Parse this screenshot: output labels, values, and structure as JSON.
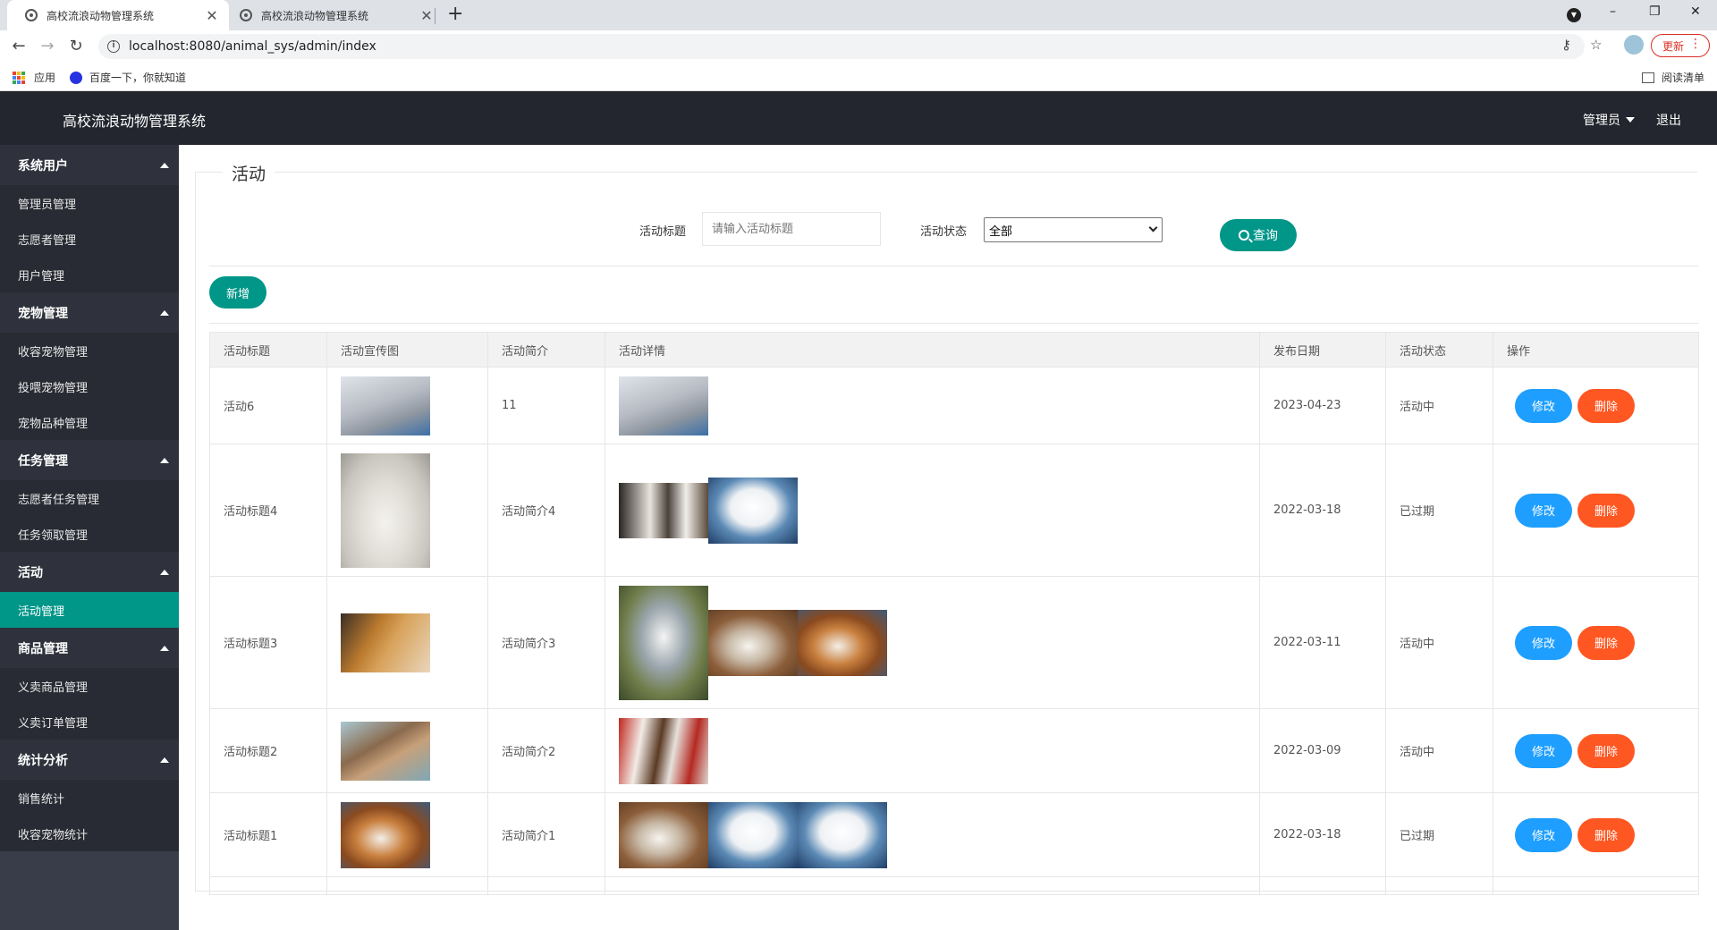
{
  "browser": {
    "tabs": [
      {
        "title": "高校流浪动物管理系统",
        "close": "✕"
      },
      {
        "title": "高校流浪动物管理系统",
        "close": "✕"
      }
    ],
    "new_tab": "+",
    "controls": {
      "minimize": "–",
      "maximize": "❐",
      "close": "✕"
    },
    "url": "localhost:8080/animal_sys/admin/index",
    "update_label": "更新",
    "bookmarks": {
      "apps": "应用",
      "baidu": "百度一下，你就知道",
      "reading_list": "阅读清单"
    }
  },
  "header": {
    "title": "高校流浪动物管理系统",
    "user": "管理员",
    "logout": "退出"
  },
  "sidebar": {
    "groups": [
      {
        "label": "系统用户",
        "items": [
          "管理员管理",
          "志愿者管理",
          "用户管理"
        ]
      },
      {
        "label": "宠物管理",
        "items": [
          "收容宠物管理",
          "投喂宠物管理",
          "宠物品种管理"
        ]
      },
      {
        "label": "任务管理",
        "items": [
          "志愿者任务管理",
          "任务领取管理"
        ]
      },
      {
        "label": "活动",
        "items": [
          "活动管理"
        ]
      },
      {
        "label": "商品管理",
        "items": [
          "义卖商品管理",
          "义卖订单管理"
        ]
      },
      {
        "label": "统计分析",
        "items": [
          "销售统计",
          "收容宠物统计"
        ]
      }
    ],
    "active_item": "活动管理"
  },
  "main": {
    "legend": "活动",
    "search": {
      "title_label": "活动标题",
      "title_placeholder": "请输入活动标题",
      "status_label": "活动状态",
      "status_value": "全部",
      "query_button": "查询"
    },
    "add_button": "新增",
    "table": {
      "columns": [
        "活动标题",
        "活动宣传图",
        "活动简介",
        "活动详情",
        "发布日期",
        "活动状态",
        "操作"
      ],
      "edit_label": "修改",
      "delete_label": "删除",
      "rows": [
        {
          "title": "活动6",
          "intro": "11",
          "date": "2023-04-23",
          "status": "活动中",
          "cover": "cat-gray-photo",
          "details": [
            "cat-gray-photo"
          ]
        },
        {
          "title": "活动标题4",
          "intro": "活动简介4",
          "date": "2022-03-18",
          "status": "已过期",
          "cover": "cockatoo-photo",
          "details": [
            "husky-puppies-photo",
            "white-dog-photo"
          ]
        },
        {
          "title": "活动标题3",
          "intro": "活动简介3",
          "date": "2022-03-11",
          "status": "活动中",
          "cover": "kittens-photo",
          "details": [
            "kite-bird-photo",
            "hamster-photo",
            "guinea-pig-photo"
          ]
        },
        {
          "title": "活动标题2",
          "intro": "活动简介2",
          "date": "2022-03-09",
          "status": "活动中",
          "cover": "monkey-photo",
          "details": [
            "christmas-pets-photo"
          ]
        },
        {
          "title": "活动标题1",
          "intro": "活动简介1",
          "date": "2022-03-18",
          "status": "已过期",
          "cover": "guinea-pig-photo",
          "details": [
            "hamster-photo",
            "white-dog-photo",
            "white-dog-photo"
          ]
        }
      ]
    }
  },
  "colors": {
    "header_bg": "#23262e",
    "sidebar_bg": "#393d49",
    "accent": "#009688",
    "edit": "#1e9fff",
    "delete": "#ff5722"
  }
}
